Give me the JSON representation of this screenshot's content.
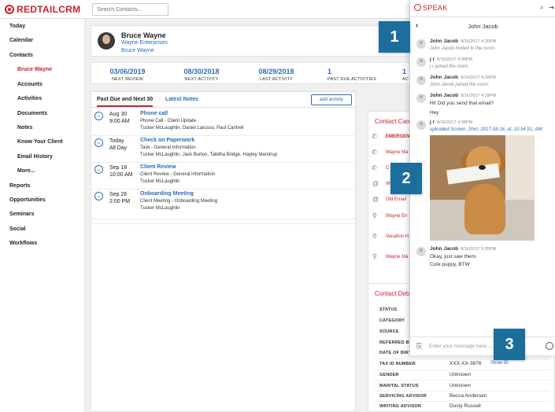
{
  "brand": {
    "name": "REDTAILCRM"
  },
  "search": {
    "placeholder": "Search Contacts..."
  },
  "sidebar": {
    "items": [
      {
        "label": "Today"
      },
      {
        "label": "Calendar"
      },
      {
        "label": "Contacts"
      },
      {
        "label": "Bruce Wayne",
        "active": true
      },
      {
        "label": "Accounts"
      },
      {
        "label": "Activities"
      },
      {
        "label": "Documents"
      },
      {
        "label": "Notes"
      },
      {
        "label": "Know Your Client"
      },
      {
        "label": "Email History"
      },
      {
        "label": "More..."
      },
      {
        "label": "Reports"
      },
      {
        "label": "Opportunities"
      },
      {
        "label": "Seminars"
      },
      {
        "label": "Social"
      },
      {
        "label": "Workflows"
      }
    ]
  },
  "contact": {
    "name": "Bruce Wayne",
    "company": "Wayne Enterprises",
    "link": "Bruce Wayne"
  },
  "stats": [
    {
      "value": "03/06/2019",
      "label": "NEXT REVIEW"
    },
    {
      "value": "08/30/2018",
      "label": "NEXT ACTIVITY"
    },
    {
      "value": "08/29/2018",
      "label": "LAST ACTIVITY"
    },
    {
      "value": "1",
      "label": "PAST DUE ACTIVITIES"
    },
    {
      "value": "1",
      "label": "AC"
    }
  ],
  "activities": {
    "tabs": [
      "Past Due and Next 30",
      "Latest Notes"
    ],
    "add_label": "add activity",
    "rows": [
      {
        "date": "Aug 30",
        "time": "9:00 AM",
        "title": "Phone call",
        "line1": "Phone Call - Client Update",
        "line2": "Tucker McLaughlin, Daniel Larusso, Paul Cantrell"
      },
      {
        "date": "Today",
        "time": "All Day",
        "title": "Check on Paperwork",
        "line1": "Task - General Information",
        "line2": "Tucker McLaughlin, Jack Burton, Tabitha Bridge, Hayley Mandrup"
      },
      {
        "date": "Sep 18",
        "time": "10:00 AM",
        "title": "Client Review",
        "line1": "Client Review - General Information",
        "line2": "Tucker McLaughlin"
      },
      {
        "date": "Sep 26",
        "time": "2:00 PM",
        "title": "Onboarding Meeting",
        "line1": "Client Meeting - Onboarding Meeting",
        "line2": "Tucker McLaughlin"
      }
    ]
  },
  "contact_card": {
    "title": "Contact Card",
    "rows": [
      "EMERGEN",
      "Wayne Ma",
      "C",
      "W",
      "Old Email",
      "Wayne En",
      "Vacation H",
      "Wayne Ma"
    ]
  },
  "details": {
    "title": "Contact Deta",
    "labels": [
      "STATUS",
      "CATEGORY",
      "SOURCE",
      "REFERRED BY",
      "DATE OF BIRTH",
      "TAX ID NUMBER",
      "GENDER",
      "MARITAL STATUS",
      "SERVICING ADVISOR",
      "WRITING ADVISOR"
    ],
    "values": {
      "tax_id": "XXX-XX-3876",
      "show_id": "Show ID",
      "gender": "Unknown",
      "marital": "Unknown",
      "servicing": "Becca Andersen",
      "writing": "Dusty Russell"
    }
  },
  "speak": {
    "logo": "SPEAK",
    "conversation_name": "John Jacob",
    "messages": [
      {
        "sender": "John Jacob",
        "time": "8/16/2017 4:30PM",
        "text": "John Jacob invited to the room.",
        "kind": "system"
      },
      {
        "sender": "j r",
        "time": "8/16/2017 4:30PM",
        "text": "j r joined the room.",
        "kind": "system"
      },
      {
        "sender": "John Jacob",
        "time": "8/16/2017 4:33PM",
        "text": "John Jacob joined the room.",
        "kind": "system"
      },
      {
        "sender": "John Jacob",
        "time": "8/16/2017 4:33PM",
        "text": "Hi! Did you send that email?",
        "text2": "Hey",
        "kind": "text"
      },
      {
        "sender": "j r",
        "time": "8/16/2017 4:38PM",
        "text": "uploaded Screen_Shot_2017-08-16_at_10.54.51_AM",
        "kind": "file"
      },
      {
        "sender": "John Jacob",
        "time": "8/16/2017 5:05PM",
        "text": "Okay, just saw them.",
        "text2": "Cute puppy, BTW",
        "kind": "text"
      }
    ],
    "input_placeholder": "Enter your message here..."
  },
  "callouts": [
    "1",
    "2",
    "3"
  ],
  "colors": {
    "brand_red": "#c8202f",
    "link_blue": "#2a6ebb",
    "callout_blue": "#1c6e9d"
  }
}
